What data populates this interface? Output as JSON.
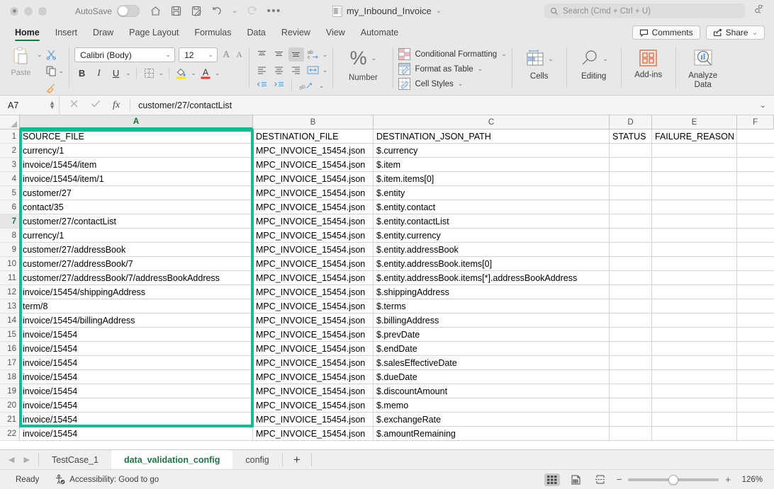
{
  "titlebar": {
    "autosave_label": "AutoSave",
    "autosave_state": "off",
    "document_name": "my_Inbound_Invoice",
    "search_placeholder": "Search (Cmd + Ctrl + U)",
    "quick_access": [
      "home-icon",
      "save-icon",
      "save-as-icon",
      "undo-icon",
      "redo-icon",
      "more-icon"
    ]
  },
  "ribbon_tabs": [
    {
      "label": "Home",
      "active": true
    },
    {
      "label": "Insert",
      "active": false
    },
    {
      "label": "Draw",
      "active": false
    },
    {
      "label": "Page Layout",
      "active": false
    },
    {
      "label": "Formulas",
      "active": false
    },
    {
      "label": "Data",
      "active": false
    },
    {
      "label": "Review",
      "active": false
    },
    {
      "label": "View",
      "active": false
    },
    {
      "label": "Automate",
      "active": false
    }
  ],
  "header_buttons": {
    "comments": "Comments",
    "share": "Share"
  },
  "ribbon": {
    "paste_label": "Paste",
    "font_name": "Calibri (Body)",
    "font_size": "12",
    "grow_font": "A",
    "shrink_font": "A",
    "bold": "B",
    "italic": "I",
    "underline": "U",
    "number_label": "Number",
    "conditional_formatting": "Conditional Formatting",
    "format_as_table": "Format as Table",
    "cell_styles": "Cell Styles",
    "cells_label": "Cells",
    "editing_label": "Editing",
    "addins_label": "Add-ins",
    "analyze_data_label": "Analyze Data",
    "analyze_data_line1": "Analyze",
    "analyze_data_line2": "Data"
  },
  "formula_bar": {
    "name_box": "A7",
    "formula_value": "customer/27/contactList"
  },
  "grid": {
    "columns": [
      "A",
      "B",
      "C",
      "D",
      "E",
      "F"
    ],
    "selected_column": "A",
    "active_row": 7,
    "row_numbers": [
      1,
      2,
      3,
      4,
      5,
      6,
      7,
      8,
      9,
      10,
      11,
      12,
      13,
      14,
      15,
      16,
      17,
      18,
      19,
      20,
      21,
      22
    ],
    "headers": {
      "A": "SOURCE_FILE",
      "B": "DESTINATION_FILE",
      "C": "DESTINATION_JSON_PATH",
      "D": "STATUS",
      "E": "FAILURE_REASON",
      "F": ""
    },
    "rows": [
      {
        "n": 1,
        "A": "SOURCE_FILE",
        "B": "DESTINATION_FILE",
        "C": "DESTINATION_JSON_PATH",
        "D": "STATUS",
        "E": "FAILURE_REASON",
        "F": ""
      },
      {
        "n": 2,
        "A": "currency/1",
        "B": "MPC_INVOICE_15454.json",
        "C": "$.currency",
        "D": "",
        "E": "",
        "F": ""
      },
      {
        "n": 3,
        "A": "invoice/15454/item",
        "B": "MPC_INVOICE_15454.json",
        "C": "$.item",
        "D": "",
        "E": "",
        "F": ""
      },
      {
        "n": 4,
        "A": "invoice/15454/item/1",
        "B": "MPC_INVOICE_15454.json",
        "C": "$.item.items[0]",
        "D": "",
        "E": "",
        "F": ""
      },
      {
        "n": 5,
        "A": "customer/27",
        "B": "MPC_INVOICE_15454.json",
        "C": "$.entity",
        "D": "",
        "E": "",
        "F": ""
      },
      {
        "n": 6,
        "A": "contact/35",
        "B": "MPC_INVOICE_15454.json",
        "C": "$.entity.contact",
        "D": "",
        "E": "",
        "F": ""
      },
      {
        "n": 7,
        "A": "customer/27/contactList",
        "B": "MPC_INVOICE_15454.json",
        "C": "$.entity.contactList",
        "D": "",
        "E": "",
        "F": ""
      },
      {
        "n": 8,
        "A": "currency/1",
        "B": "MPC_INVOICE_15454.json",
        "C": "$.entity.currency",
        "D": "",
        "E": "",
        "F": ""
      },
      {
        "n": 9,
        "A": "customer/27/addressBook",
        "B": "MPC_INVOICE_15454.json",
        "C": "$.entity.addressBook",
        "D": "",
        "E": "",
        "F": ""
      },
      {
        "n": 10,
        "A": "customer/27/addressBook/7",
        "B": "MPC_INVOICE_15454.json",
        "C": "$.entity.addressBook.items[0]",
        "D": "",
        "E": "",
        "F": ""
      },
      {
        "n": 11,
        "A": "customer/27/addressBook/7/addressBookAddress",
        "B": "MPC_INVOICE_15454.json",
        "C": "$.entity.addressBook.items[*].addressBookAddress",
        "D": "",
        "E": "",
        "F": ""
      },
      {
        "n": 12,
        "A": "invoice/15454/shippingAddress",
        "B": "MPC_INVOICE_15454.json",
        "C": "$.shippingAddress",
        "D": "",
        "E": "",
        "F": ""
      },
      {
        "n": 13,
        "A": "term/8",
        "B": "MPC_INVOICE_15454.json",
        "C": "$.terms",
        "D": "",
        "E": "",
        "F": ""
      },
      {
        "n": 14,
        "A": "invoice/15454/billingAddress",
        "B": "MPC_INVOICE_15454.json",
        "C": "$.billingAddress",
        "D": "",
        "E": "",
        "F": ""
      },
      {
        "n": 15,
        "A": "invoice/15454",
        "B": "MPC_INVOICE_15454.json",
        "C": "$.prevDate",
        "D": "",
        "E": "",
        "F": ""
      },
      {
        "n": 16,
        "A": "invoice/15454",
        "B": "MPC_INVOICE_15454.json",
        "C": "$.endDate",
        "D": "",
        "E": "",
        "F": ""
      },
      {
        "n": 17,
        "A": "invoice/15454",
        "B": "MPC_INVOICE_15454.json",
        "C": "$.salesEffectiveDate",
        "D": "",
        "E": "",
        "F": ""
      },
      {
        "n": 18,
        "A": "invoice/15454",
        "B": "MPC_INVOICE_15454.json",
        "C": "$.dueDate",
        "D": "",
        "E": "",
        "F": ""
      },
      {
        "n": 19,
        "A": "invoice/15454",
        "B": "MPC_INVOICE_15454.json",
        "C": "$.discountAmount",
        "D": "",
        "E": "",
        "F": ""
      },
      {
        "n": 20,
        "A": "invoice/15454",
        "B": "MPC_INVOICE_15454.json",
        "C": "$.memo",
        "D": "",
        "E": "",
        "F": ""
      },
      {
        "n": 21,
        "A": "invoice/15454",
        "B": "MPC_INVOICE_15454.json",
        "C": "$.exchangeRate",
        "D": "",
        "E": "",
        "F": ""
      },
      {
        "n": 22,
        "A": "invoice/15454",
        "B": "MPC_INVOICE_15454.json",
        "C": "$.amountRemaining",
        "D": "",
        "E": "",
        "F": ""
      }
    ]
  },
  "sheet_tabs": [
    {
      "label": "TestCase_1",
      "active": false
    },
    {
      "label": "data_validation_config",
      "active": true
    },
    {
      "label": "config",
      "active": false
    }
  ],
  "sheet_add_label": "+",
  "status_bar": {
    "state": "Ready",
    "accessibility": "Accessibility: Good to go",
    "zoom": "126%",
    "zoom_out": "−",
    "zoom_in": "+"
  },
  "colors": {
    "selection_border": "#15bb96",
    "accent_green": "#217346",
    "active_tab_text": "#217346"
  }
}
